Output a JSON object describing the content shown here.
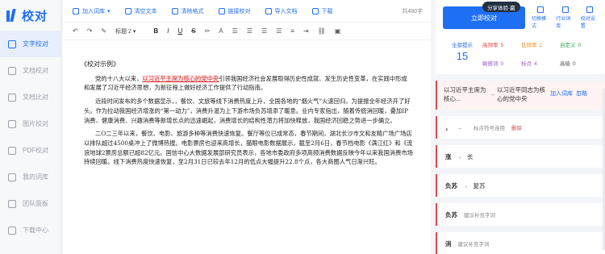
{
  "app": {
    "logo": "校对"
  },
  "sidebar": {
    "items": [
      {
        "label": "文字校对",
        "icon": "text-icon",
        "active": true
      },
      {
        "label": "文档校对",
        "icon": "doc-icon"
      },
      {
        "label": "文档比对",
        "icon": "compare-icon"
      },
      {
        "label": "图片校对",
        "icon": "image-icon"
      },
      {
        "label": "PDF校对",
        "icon": "pdf-icon"
      },
      {
        "label": "我的词库",
        "icon": "book-icon"
      },
      {
        "label": "团队面板",
        "icon": "team-icon"
      },
      {
        "label": "下载中心",
        "icon": "download-icon"
      }
    ]
  },
  "toolbar": {
    "add_dict": "加入词库",
    "clear_text": "清空文本",
    "clear_format": "清除格式",
    "link_check": "链接校对",
    "import_doc": "导入文档",
    "download": "下载",
    "word_count": "共480字",
    "heading": "标题 2",
    "dropdown_arrow": "▾"
  },
  "editor": {
    "title": "《校对示例》",
    "p1_a": "党的十八大以来，",
    "p1_hl": "以习近平主席为核心的党中央",
    "p1_b": "引领我国经济社会发展取得历史性成就、发生历史性变革，在实践中形成和发展了习近平经济思想，为新征程上做好经济工作提供了行动指南。",
    "p2": "近段时间发布的多个数据显示，，餐饮、文旅等线下消费热度上升，全国各地的“烟火气”火速回归，为提振全年经济开了好头。作为拉动我国经济增涨的“第一动力”，消费升温为上下游市场负苏增添了暖意。业内专家指出，随着传统消回暖，叠加IP消费、健康消费、兴趣消费等新增长点的迅速崛起，消费增长的结构性潜力将加快释放，我国经济回稳之势进一步确立。",
    "p3": "二O二三年以来，餐饮、电影、旅游多种等消费快速恢复。餐厅等位已成常态，春节期间，湖北长沙市文和友精广场广场店以排队超过4500桌冲上了微博热搜。电影票房也迎来高增长，猫眼电影数据展示，截至2月6日，春节档电影《满江红》和《流浪地球2票房总额已超82亿元。国信中心大数据发展部研究员表示，各地市委政府多项高频消费数据反映今年以来我国消费市场持续回暖。线下消费热度快速恢复，至2月31日已较去年12月的低点大幅提升22.8个点，各大商圈人气日渐兴旺。"
  },
  "panel": {
    "share": "分享体验·赢",
    "check_button": "立即校对",
    "modes": [
      "切换模式",
      "行业词库",
      "校对设置"
    ],
    "total_label": "全部提示",
    "total": "15",
    "stats": [
      {
        "label": "高频率",
        "value": "5",
        "color": "#e04a4a"
      },
      {
        "label": "低频率",
        "value": "2",
        "color": "#f0902a"
      },
      {
        "label": "自定义",
        "value": "0",
        "color": "#2ba84a"
      },
      {
        "label": "敏感词",
        "value": "0",
        "color": "#9b59d0"
      },
      {
        "label": "标点",
        "value": "4",
        "color": "#9b59d0"
      },
      {
        "label": "高级",
        "value": "0",
        "color": "#555555"
      }
    ],
    "error": {
      "original": "以习近平主席为核心...",
      "suggestion": "以习近平同志为核心的党中央",
      "add": "加入词库",
      "ignore": "忽略"
    },
    "cards": [
      {
        "orig": "，",
        "arrow": "→",
        "sub": "标点符号连用",
        "action": "删除"
      },
      {
        "orig": "涨",
        "arrow": "→",
        "sugg": "长"
      },
      {
        "orig": "负苏",
        "arrow": "→",
        "sugg": "复苏"
      },
      {
        "orig": "负苏",
        "sub": "建议补充字词"
      },
      {
        "orig": "消",
        "sub": "建议补充字词"
      }
    ]
  }
}
